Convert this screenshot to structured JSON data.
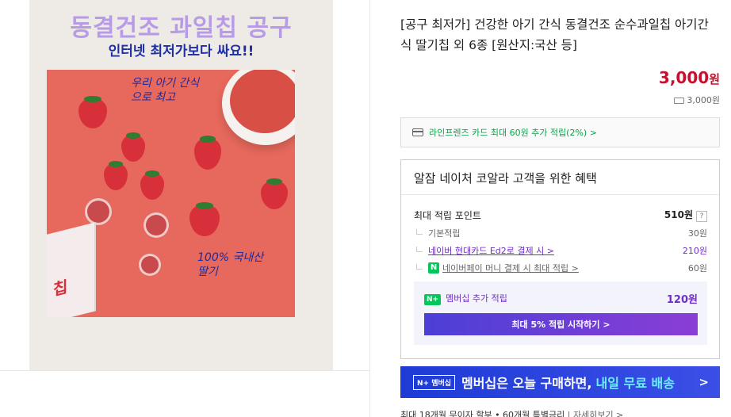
{
  "image": {
    "promo_title": "동결건조 과일칩 공구",
    "promo_subtitle": "인터넷 최저가보다 싸요!!",
    "note_top": "우리 아기 간식\n으로 최고",
    "note_bottom": "100% 국내산\n딸기",
    "bag_text": "칩"
  },
  "product": {
    "title": "[공구 최저가] 건강한 아기 간식 동결건조 순수과일칩 아기간식 딸기칩 외 6종 [원산지:국산 등]",
    "price": "3,000",
    "price_unit": "원",
    "delivery_fee": "3,000원"
  },
  "card_promo": {
    "text": "라인프렌즈 카드 최대 60원 추가 적립(2%) >"
  },
  "benefit": {
    "header": "알잠 네이처 코알라 고객을 위한 혜택",
    "max_points_label": "최대 적립 포인트",
    "max_points_value": "510원",
    "help_icon": "?",
    "rows": [
      {
        "label": "기본적립",
        "value": "30원"
      },
      {
        "label": "네이버 현대카드 Ed2로 결제 시 >",
        "value": "210원"
      },
      {
        "label": "네이버페이 머니 결제 시 최대 적립 >",
        "value": "60원"
      }
    ],
    "npay_badge": "N",
    "membership_badge": "N+",
    "membership_label": "멤버십 추가 적립",
    "membership_value": "120원",
    "membership_button": "최대 5% 적립 시작하기 >"
  },
  "banner": {
    "logo": "N+ 멤버십",
    "text": "멤버십은 오늘 구매하면,",
    "highlight": "내일 무료 배송",
    "arrow": ">"
  },
  "footnote": {
    "text": "최대 18개월 무이자 할부 • 60개월 특별금리",
    "more": "| 자세히보기 >"
  },
  "colors": {
    "price": "#c8102e",
    "green": "#06a447",
    "purple": "#6f2ec7",
    "banner": "#1e3bd6"
  }
}
